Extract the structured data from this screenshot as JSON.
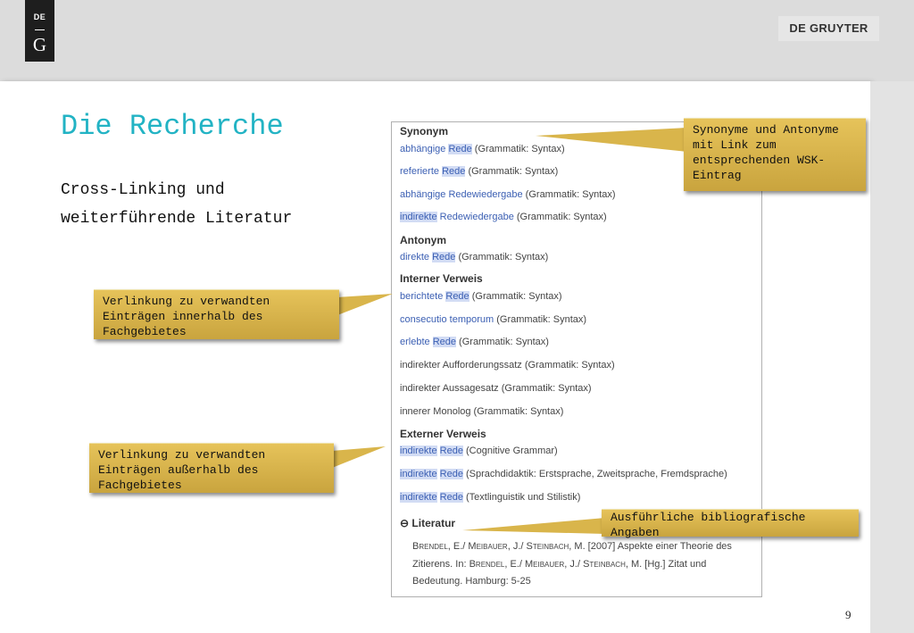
{
  "header": {
    "logo_top": "DE",
    "logo_letter": "G",
    "brand": "DE GRUYTER"
  },
  "slide": {
    "title": "Die Recherche",
    "subtitle_line1": "Cross-Linking und",
    "subtitle_line2": "weiterführende Literatur",
    "page_number": "9"
  },
  "panel": {
    "sections": {
      "synonym": "Synonym",
      "antonym": "Antonym",
      "internal": "Interner Verweis",
      "external": "Externer Verweis",
      "literature": "Literatur"
    },
    "synonym_rows": [
      {
        "link": "abhängige",
        "hl": "Rede",
        "rest": " (Grammatik: Syntax)"
      },
      {
        "link": "referierte",
        "hl": "Rede",
        "rest": " (Grammatik: Syntax)"
      },
      {
        "link": "abhängige Redewiedergabe",
        "hl": "",
        "rest": " (Grammatik: Syntax)"
      },
      {
        "pre_hl": "indirekte",
        "link": "Redewiedergabe",
        "rest": " (Grammatik: Syntax)"
      }
    ],
    "antonym_rows": [
      {
        "link": "direkte",
        "hl": "Rede",
        "rest": " (Grammatik: Syntax)"
      }
    ],
    "internal_rows": [
      {
        "link": "berichtete",
        "hl": "Rede",
        "rest": " (Grammatik: Syntax)"
      },
      {
        "link": "consecutio temporum",
        "hl": "",
        "rest": " (Grammatik: Syntax)"
      },
      {
        "link": "erlebte",
        "hl": "Rede",
        "rest": " (Grammatik: Syntax)"
      },
      {
        "plain": "indirekter Aufforderungssatz (Grammatik: Syntax)"
      },
      {
        "plain": "indirekter Aussagesatz (Grammatik: Syntax)"
      },
      {
        "plain": "innerer Monolog (Grammatik: Syntax)"
      }
    ],
    "external_rows": [
      {
        "pre_hl": "indirekte",
        "hl": "Rede",
        "rest": " (Cognitive Grammar)"
      },
      {
        "pre_hl": "indirekte",
        "hl": "Rede",
        "rest": " (Sprachdidaktik: Erstsprache, Zweitsprache, Fremdsprache)"
      },
      {
        "pre_hl": "indirekte",
        "hl": "Rede",
        "rest": " (Textlinguistik und Stilistik)"
      }
    ],
    "literature_toggle": "⊖",
    "literature": {
      "a1": "Brendel",
      "t1": ", E./ ",
      "a2": "Meibauer",
      "t2": ", J./ ",
      "a3": "Steinbach",
      "t3": ", M. [2007] Aspekte einer Theorie des Zitierens. In: ",
      "a4": "Brendel",
      "t4": ", E./ ",
      "a5": "Meibauer",
      "t5": ", J./ ",
      "a6": "Steinbach",
      "t6": ", M. [Hg.] Zitat und Bedeutung. Hamburg: 5-25"
    }
  },
  "callouts": {
    "synonyms": "Synonyme und Antonyme mit Link zum entsprechenden WSK-Eintrag",
    "internal": "Verlinkung zu verwandten Einträgen innerhalb des Fachgebietes",
    "external": "Verlinkung zu verwandten Einträgen außerhalb des Fachgebietes",
    "literature": "Ausführliche bibliografische Angaben"
  },
  "colors": {
    "title": "#22b3c4",
    "link": "#3b5fb3",
    "highlight": "#d2dcf4",
    "callout": "#d9b54b"
  }
}
